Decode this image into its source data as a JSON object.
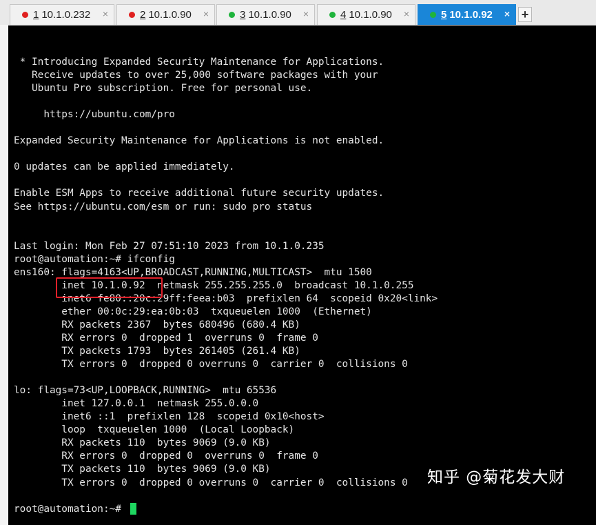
{
  "tabs": [
    {
      "number": "1",
      "label": "10.1.0.232",
      "status_color": "#e0201f",
      "active": false
    },
    {
      "number": "2",
      "label": "10.1.0.90",
      "status_color": "#e0201f",
      "active": false
    },
    {
      "number": "3",
      "label": "10.1.0.90",
      "status_color": "#1fb43c",
      "active": false
    },
    {
      "number": "4",
      "label": "10.1.0.90",
      "status_color": "#1fb43c",
      "active": false
    },
    {
      "number": "5",
      "label": "10.1.0.92",
      "status_color": "#1fb43c",
      "active": true
    }
  ],
  "tab_close_glyph": "×",
  "add_tab_label": "+",
  "terminal": {
    "lines": [
      " * Introducing Expanded Security Maintenance for Applications.",
      "   Receive updates to over 25,000 software packages with your",
      "   Ubuntu Pro subscription. Free for personal use.",
      "",
      "     https://ubuntu.com/pro",
      "",
      "Expanded Security Maintenance for Applications is not enabled.",
      "",
      "0 updates can be applied immediately.",
      "",
      "Enable ESM Apps to receive additional future security updates.",
      "See https://ubuntu.com/esm or run: sudo pro status",
      "",
      "",
      "Last login: Mon Feb 27 07:51:10 2023 from 10.1.0.235",
      "root@automation:~# ifconfig",
      "ens160: flags=4163<UP,BROADCAST,RUNNING,MULTICAST>  mtu 1500",
      "        inet 10.1.0.92  netmask 255.255.255.0  broadcast 10.1.0.255",
      "        inet6 fe80::20c:29ff:feea:b03  prefixlen 64  scopeid 0x20<link>",
      "        ether 00:0c:29:ea:0b:03  txqueuelen 1000  (Ethernet)",
      "        RX packets 2367  bytes 680496 (680.4 KB)",
      "        RX errors 0  dropped 1  overruns 0  frame 0",
      "        TX packets 1793  bytes 261405 (261.4 KB)",
      "        TX errors 0  dropped 0 overruns 0  carrier 0  collisions 0",
      "",
      "lo: flags=73<UP,LOOPBACK,RUNNING>  mtu 65536",
      "        inet 127.0.0.1  netmask 255.0.0.0",
      "        inet6 ::1  prefixlen 128  scopeid 0x10<host>",
      "        loop  txqueuelen 1000  (Local Loopback)",
      "        RX packets 110  bytes 9069 (9.0 KB)",
      "        RX errors 0  dropped 0  overruns 0  frame 0",
      "        TX packets 110  bytes 9069 (9.0 KB)",
      "        TX errors 0  dropped 0 overruns 0  carrier 0  collisions 0",
      "",
      "root@automation:~# "
    ],
    "background": "#000000",
    "text_color": "#e4e4e4",
    "cursor_color": "#1ed760",
    "highlight_color": "#e0202a"
  },
  "watermark": "知乎 @菊花发大财"
}
